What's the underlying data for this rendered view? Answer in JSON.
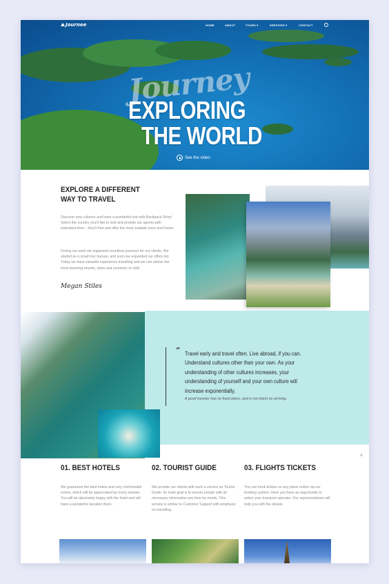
{
  "nav": {
    "logo": "Journee",
    "items": [
      "HOME",
      "ABOUT",
      "TOURS",
      "SERVICES",
      "CONTACT"
    ]
  },
  "hero": {
    "script_text": "Journey",
    "title_line1": "EXPLORING",
    "title_line2": "THE WORLD",
    "video_link": "See the video"
  },
  "about": {
    "title": "EXPLORE A DIFFERENT WAY TO TRAVEL",
    "paragraph1": "Discover new cultures and have a wonderful rest with Backpack Story! Select the country you'd like to visit and provide our agents with estimated time – they'll find and offer the most suitable tours and hotels.",
    "paragraph2": "During our work we organized countless journeys for our clients. We started as a small tour bureau, and soon we expanded our offers list. Today we have valuable experience travelling and we can advise the most stunning resorts, cities and countries to visit!",
    "signature": "Megan Stiles"
  },
  "quote": {
    "mark": "“",
    "text": "Travel early and travel often. Live abroad, if you can. Understand cultures other than your own. As your understanding of other cultures increases, your understanding of yourself and your own culture will increase exponentially.",
    "cite": "A good traveler has no fixed plans, and is not intent on arriving."
  },
  "features": [
    {
      "title": "01. BEST HOTELS",
      "text": "We guarantee the best hotels and very comfortable rooms, which will be appreciated by every traveler. You will be absolutely happy with the hotel and will have a wonderful vacation there."
    },
    {
      "title": "02. TOURIST GUIDE",
      "text": "We provide our clients with such a service as Tourist Guide. Its main goal is to ensure people with all necessary information any time he needs. This service is similar to Customer Support with emphasis on travelling."
    },
    {
      "title": "03. FLIGHTS TICKETS",
      "text": "You can book tickets on any plane online via our booking system. Here you have an opportunity to select your transport operator. Our representatives will help you with the details."
    }
  ]
}
